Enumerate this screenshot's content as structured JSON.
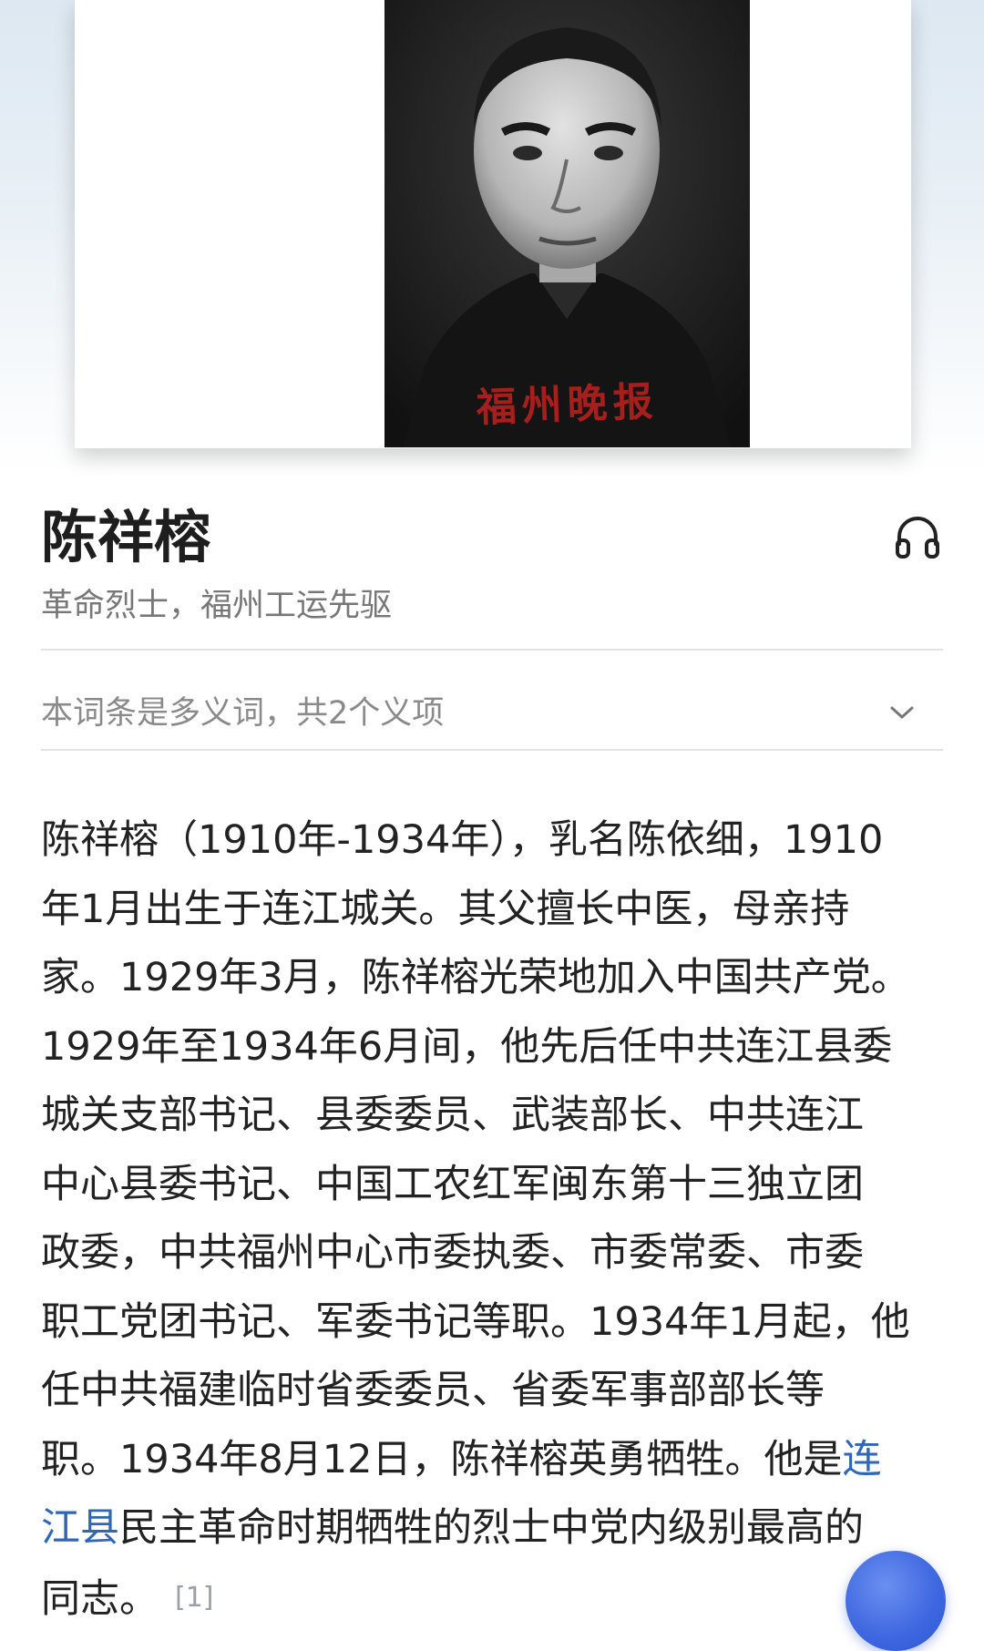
{
  "hero": {
    "watermark": "福州晚报"
  },
  "entry": {
    "title": "陈祥榕",
    "subtitle": "革命烈士，福州工运先驱",
    "audio_icon": "headphones-icon"
  },
  "disambiguation": {
    "text": "本词条是多义词，共2个义项",
    "icon": "chevron-down-icon"
  },
  "summary": {
    "lines": [
      "陈祥榕（1910年-1934年），乳名陈依细，1910",
      "年1月出生于连江城关。其父擅长中医，母亲持",
      "家。1929年3月，陈祥榕光荣地加入中国共产党。",
      "1929年至1934年6月间，他先后任中共连江县委",
      "城关支部书记、县委委员、武装部长、中共连江",
      "中心县委书记、中国工农红军闽东第十三独立团",
      "政委，中共福州中心市委执委、市委常委、市委",
      "职工党团书记、军委书记等职。1934年1月起，他",
      "任中共福建临时省委委员、省委军事部部长等",
      "职。1934年8月12日，陈祥榕英勇牺牲。他是"
    ],
    "link_part1": "连",
    "link_part2": "江县",
    "line12_rest": "民主革命时期牺牲的烈士中党内级别最高的",
    "last_line": "同志。",
    "ref": "[1]"
  },
  "colors": {
    "link": "#2e66b9",
    "fab": "#3d66e0"
  }
}
